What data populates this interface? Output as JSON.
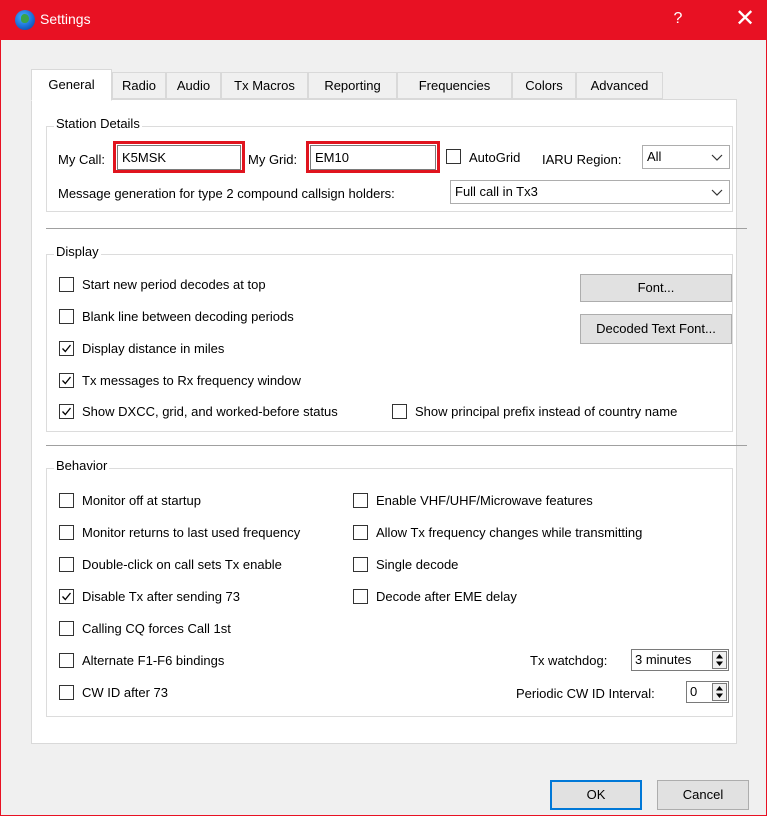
{
  "window": {
    "title": "Settings",
    "help": "?",
    "close": "✕"
  },
  "tabs": [
    {
      "label": "General"
    },
    {
      "label": "Radio"
    },
    {
      "label": "Audio"
    },
    {
      "label": "Tx Macros"
    },
    {
      "label": "Reporting"
    },
    {
      "label": "Frequencies"
    },
    {
      "label": "Colors"
    },
    {
      "label": "Advanced"
    }
  ],
  "active_tab": "General",
  "station": {
    "group_title": "Station Details",
    "my_call_label": "My Call:",
    "my_call_value": "K5MSK",
    "my_grid_label": "My Grid:",
    "my_grid_value": "EM10",
    "autogrid_label": "AutoGrid",
    "autogrid_checked": false,
    "iaru_label": "IARU Region:",
    "iaru_value": "All",
    "msg_gen_label": "Message generation for type 2 compound callsign holders:",
    "msg_gen_value": "Full call in Tx3"
  },
  "display": {
    "group_title": "Display",
    "start_new_period": {
      "label": "Start new period decodes at top",
      "checked": false
    },
    "blank_line": {
      "label": "Blank line between decoding periods",
      "checked": false
    },
    "distance_miles": {
      "label": "Display distance in miles",
      "checked": true
    },
    "tx_to_rx": {
      "label": "Tx messages to Rx frequency window",
      "checked": true
    },
    "show_dxcc": {
      "label": "Show DXCC, grid, and worked-before status",
      "checked": true
    },
    "principal_prefix": {
      "label": "Show principal prefix instead of country name",
      "checked": false
    },
    "font_button": "Font...",
    "decoded_font_button": "Decoded Text Font..."
  },
  "behavior": {
    "group_title": "Behavior",
    "monitor_off": {
      "label": "Monitor off at startup",
      "checked": false
    },
    "monitor_returns": {
      "label": "Monitor returns to last used frequency",
      "checked": false
    },
    "double_click": {
      "label": "Double-click on call sets Tx enable",
      "checked": false
    },
    "disable_tx": {
      "label": "Disable Tx after sending 73",
      "checked": true
    },
    "calling_cq": {
      "label": "Calling CQ forces Call 1st",
      "checked": false
    },
    "alt_bindings": {
      "label": "Alternate F1-F6 bindings",
      "checked": false
    },
    "cw_id": {
      "label": "CW ID after 73",
      "checked": false
    },
    "vhf": {
      "label": "Enable VHF/UHF/Microwave features",
      "checked": false
    },
    "allow_tx_freq": {
      "label": "Allow Tx frequency changes while transmitting",
      "checked": false
    },
    "single_decode": {
      "label": "Single decode",
      "checked": false
    },
    "decode_eme": {
      "label": "Decode after EME delay",
      "checked": false
    },
    "watchdog_label": "Tx watchdog:",
    "watchdog_value": "3 minutes",
    "cw_interval_label": "Periodic CW ID Interval:",
    "cw_interval_value": "0"
  },
  "footer": {
    "ok_label": "OK",
    "cancel_label": "Cancel"
  },
  "colors": {
    "titlebar": "#e81123",
    "highlight": "#e0141e",
    "accent": "#0078d7"
  }
}
